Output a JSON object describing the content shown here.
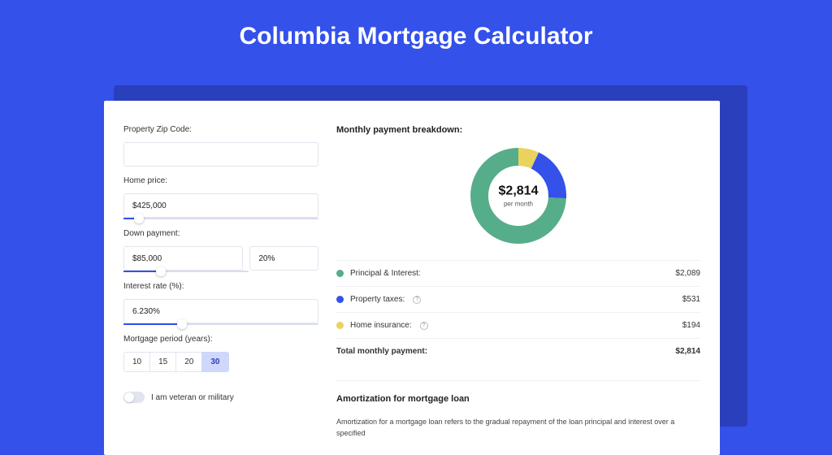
{
  "page_title": "Columbia Mortgage Calculator",
  "form": {
    "zip": {
      "label": "Property Zip Code:",
      "value": ""
    },
    "home_price": {
      "label": "Home price:",
      "value": "$425,000",
      "slider_fill": 8
    },
    "down_payment": {
      "label": "Down payment:",
      "amount": "$85,000",
      "percent": "20%",
      "slider_fill": 20
    },
    "interest_rate": {
      "label": "Interest rate (%):",
      "value": "6.230%",
      "slider_fill": 30
    },
    "mortgage_period": {
      "label": "Mortgage period (years):",
      "options": [
        "10",
        "15",
        "20",
        "30"
      ],
      "active": "30"
    },
    "veteran": {
      "label": "I am veteran or military",
      "on": false
    }
  },
  "breakdown": {
    "title": "Monthly payment breakdown:",
    "amount": "$2,814",
    "sub": "per month",
    "items": [
      {
        "label": "Principal & Interest:",
        "value": "$2,089",
        "color": "#56ad8a",
        "help": false
      },
      {
        "label": "Property taxes:",
        "value": "$531",
        "color": "#3451ea",
        "help": true
      },
      {
        "label": "Home insurance:",
        "value": "$194",
        "color": "#ead25f",
        "help": true
      }
    ],
    "total": {
      "label": "Total monthly payment:",
      "value": "$2,814"
    }
  },
  "amortization": {
    "title": "Amortization for mortgage loan",
    "text": "Amortization for a mortgage loan refers to the gradual repayment of the loan principal and interest over a specified"
  },
  "chart_data": {
    "type": "pie",
    "title": "Monthly payment breakdown",
    "series": [
      {
        "name": "Principal & Interest",
        "value": 2089,
        "color": "#56ad8a"
      },
      {
        "name": "Property taxes",
        "value": 531,
        "color": "#3451ea"
      },
      {
        "name": "Home insurance",
        "value": 194,
        "color": "#ead25f"
      }
    ],
    "center_label": "$2,814",
    "center_sub": "per month"
  }
}
